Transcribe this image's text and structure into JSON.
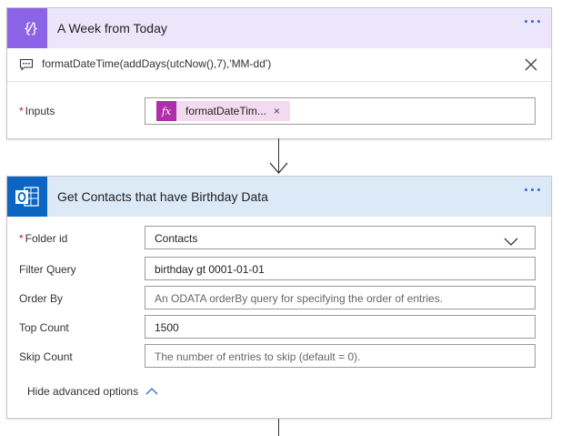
{
  "step1": {
    "title": "A Week from Today",
    "comment": "formatDateTime(addDays(utcNow(),7),'MM-dd')",
    "inputs_label": "Inputs",
    "token_label": "formatDateTim...",
    "token_remove": "×",
    "icon": "variable-braces-icon"
  },
  "step2": {
    "title": "Get Contacts that have Birthday Data",
    "icon": "outlook-icon",
    "folder_label": "Folder id",
    "folder_value": "Contacts",
    "filter_label": "Filter Query",
    "filter_value": "birthday gt 0001-01-01",
    "order_label": "Order By",
    "order_placeholder": "An ODATA orderBy query for specifying the order of entries.",
    "top_label": "Top Count",
    "top_value": "1500",
    "skip_label": "Skip Count",
    "skip_placeholder": "The number of entries to skip (default = 0).",
    "hide_advanced": "Hide advanced options"
  },
  "colors": {
    "step1_accent": "#8b63e6",
    "step1_header": "#ece6fb",
    "step2_accent": "#0a66c2",
    "step2_header": "#dceaf7",
    "expression_token": "#b02ea8",
    "link_blue": "#2d6cc4"
  }
}
